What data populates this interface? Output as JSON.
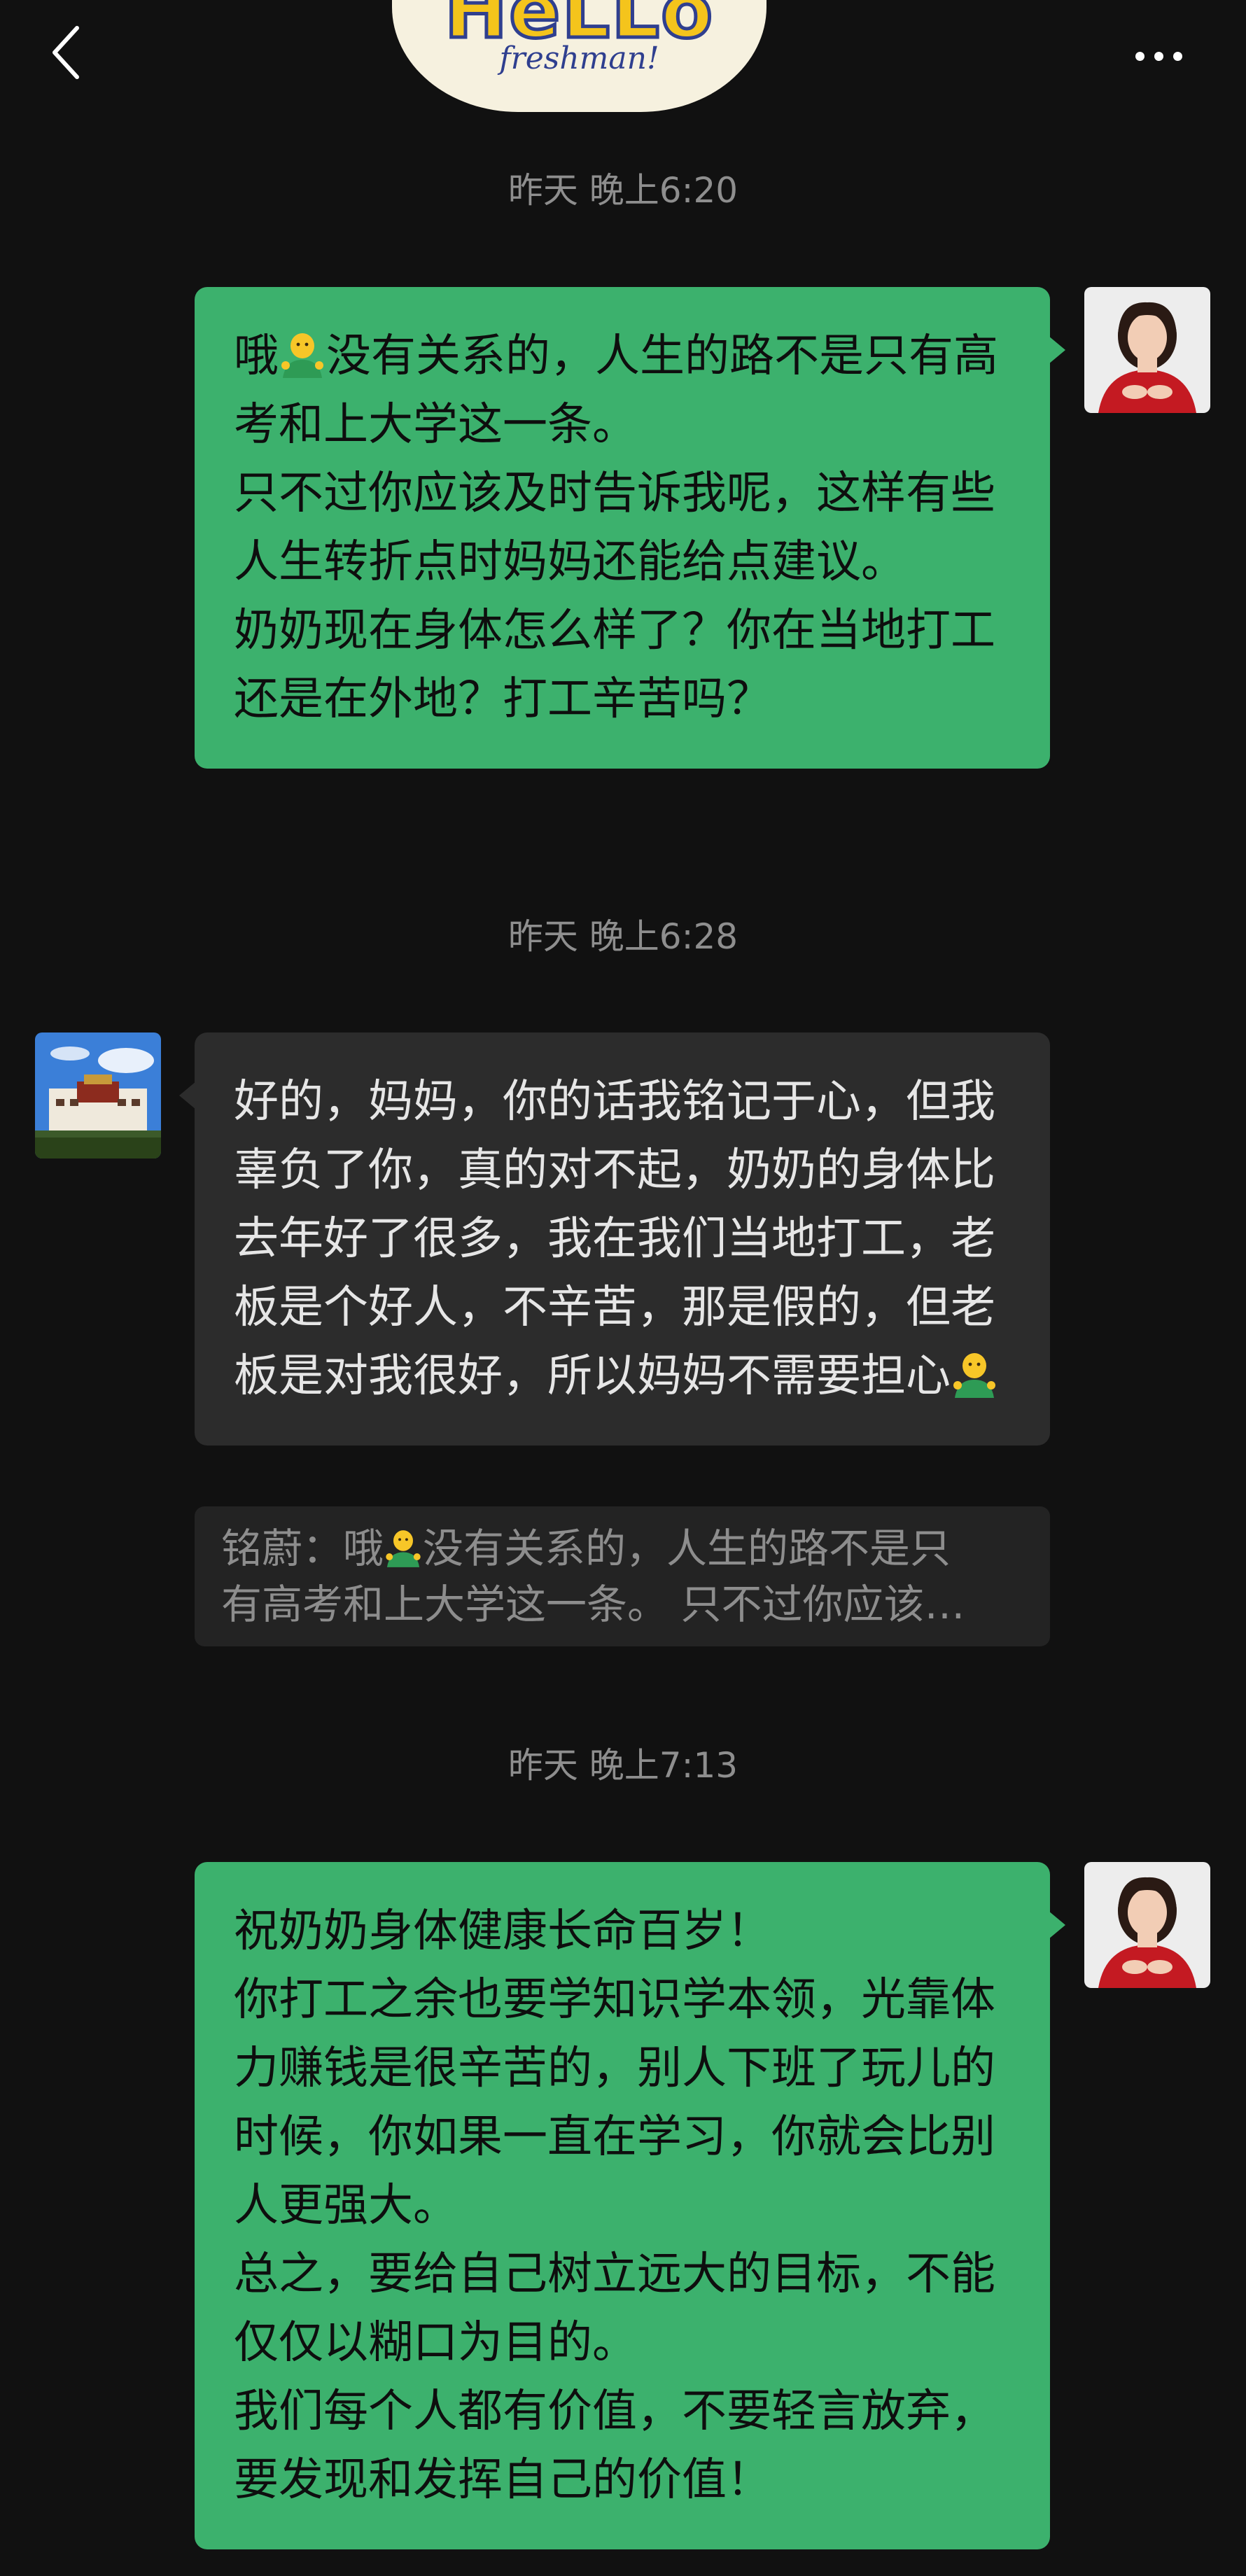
{
  "header": {
    "back_icon": "chevron-left-icon",
    "more_icon": "more-dots-icon",
    "badge_title": "HeLLo",
    "badge_subtitle": "freshman!"
  },
  "messages": [
    {
      "timestamp": "昨天 晚上6:20",
      "direction": "out",
      "paragraphs": [
        [
          "哦",
          "{emoji}",
          "没有关系的，人生的路不是只有高考和上大学这一条。"
        ],
        [
          "只不过你应该及时告诉我呢，这样有些人生转折点时妈妈还能给点建议。"
        ],
        [
          "奶奶现在身体怎么样了？你在当地打工还是在外地？打工辛苦吗？"
        ]
      ]
    },
    {
      "timestamp": "昨天 晚上6:28",
      "direction": "in",
      "paragraphs": [
        [
          "好的，妈妈，你的话我铭记于心，但我辜负了你，真的对不起，奶奶的身体比去年好了很多，我在我们当地打工，老板是个好人，不辛苦，那是假的，但老板是对我很好，所以妈妈不需要担心",
          "{emoji}"
        ]
      ],
      "quote": {
        "line1_prefix": "铭蔚：哦",
        "line1_suffix": "没有关系的，人生的路不是只",
        "line2": "有高考和上大学这一条。 只不过你应该…"
      }
    },
    {
      "timestamp": "昨天 晚上7:13",
      "direction": "out",
      "paragraphs": [
        [
          "祝奶奶身体健康长命百岁！"
        ],
        [
          "你打工之余也要学知识学本领，光靠体力赚钱是很辛苦的，别人下班了玩儿的时候，你如果一直在学习，你就会比别人更强大。"
        ],
        [
          "总之，要给自己树立远大的目标，不能仅仅以糊口为目的。"
        ],
        [
          "我们每个人都有价值，不要轻言放弃，要发现和发挥自己的价值！"
        ]
      ]
    }
  ],
  "text": {
    "m1_p1a": "哦",
    "m1_p1b": "没有关系的，人生的路不是只有高考和上大学这一条。",
    "m1_p2": "只不过你应该及时告诉我呢，这样有些人生转折点时妈妈还能给点建议。",
    "m1_p3": "奶奶现在身体怎么样了？你在当地打工还是在外地？打工辛苦吗？",
    "m2_p1": "好的，妈妈，你的话我铭记于心，但我辜负了你，真的对不起，奶奶的身体比去年好了很多，我在我们当地打工，老板是个好人，不辛苦，那是假的，但老板是对我很好，所以妈妈不需要担心",
    "m3_p1": "祝奶奶身体健康长命百岁！",
    "m3_p2": "你打工之余也要学知识学本领，光靠体力赚钱是很辛苦的，别人下班了玩儿的时候，你如果一直在学习，你就会比别人更强大。",
    "m3_p3": "总之，要给自己树立远大的目标，不能仅仅以糊口为目的。",
    "m3_p4": "我们每个人都有价值，不要轻言放弃，要发现和发挥自己的价值！",
    "ts1": "昨天 晚上6:20",
    "ts2": "昨天 晚上6:28",
    "ts3": "昨天 晚上7:13"
  },
  "colors": {
    "background": "#111111",
    "outgoing_bubble": "#3cb16d",
    "incoming_bubble": "#2c2c2c",
    "quote_bg": "#232323",
    "timestamp": "#8e8e8e"
  }
}
